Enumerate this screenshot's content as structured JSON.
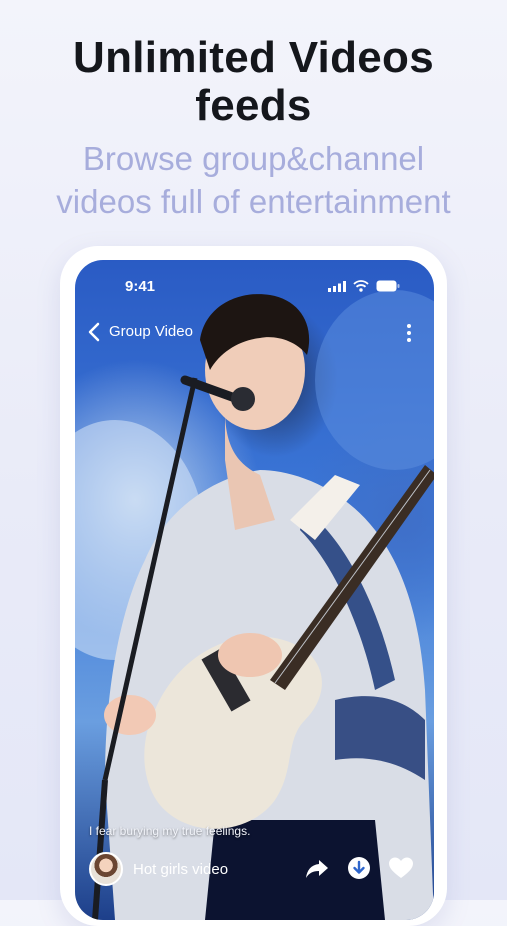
{
  "hero": {
    "title_line1": "Unlimited Videos",
    "title_line2": "feeds",
    "subtitle_line1": "Browse group&channel",
    "subtitle_line2": "videos full of entertainment"
  },
  "phone": {
    "status": {
      "time": "9:41"
    },
    "nav": {
      "title": "Group Video"
    },
    "video": {
      "caption": "I fear burying my true feelings.",
      "author": "Hot girls video"
    }
  },
  "colors": {
    "title": "#15171c",
    "subtitle": "#a7addc",
    "background": "#eceefa",
    "screen_blue": "#2f66cc"
  },
  "icons": [
    "back-chevron-icon",
    "more-vertical-icon",
    "share-icon",
    "download-icon",
    "heart-icon",
    "signal-icon",
    "wifi-icon",
    "battery-icon"
  ]
}
